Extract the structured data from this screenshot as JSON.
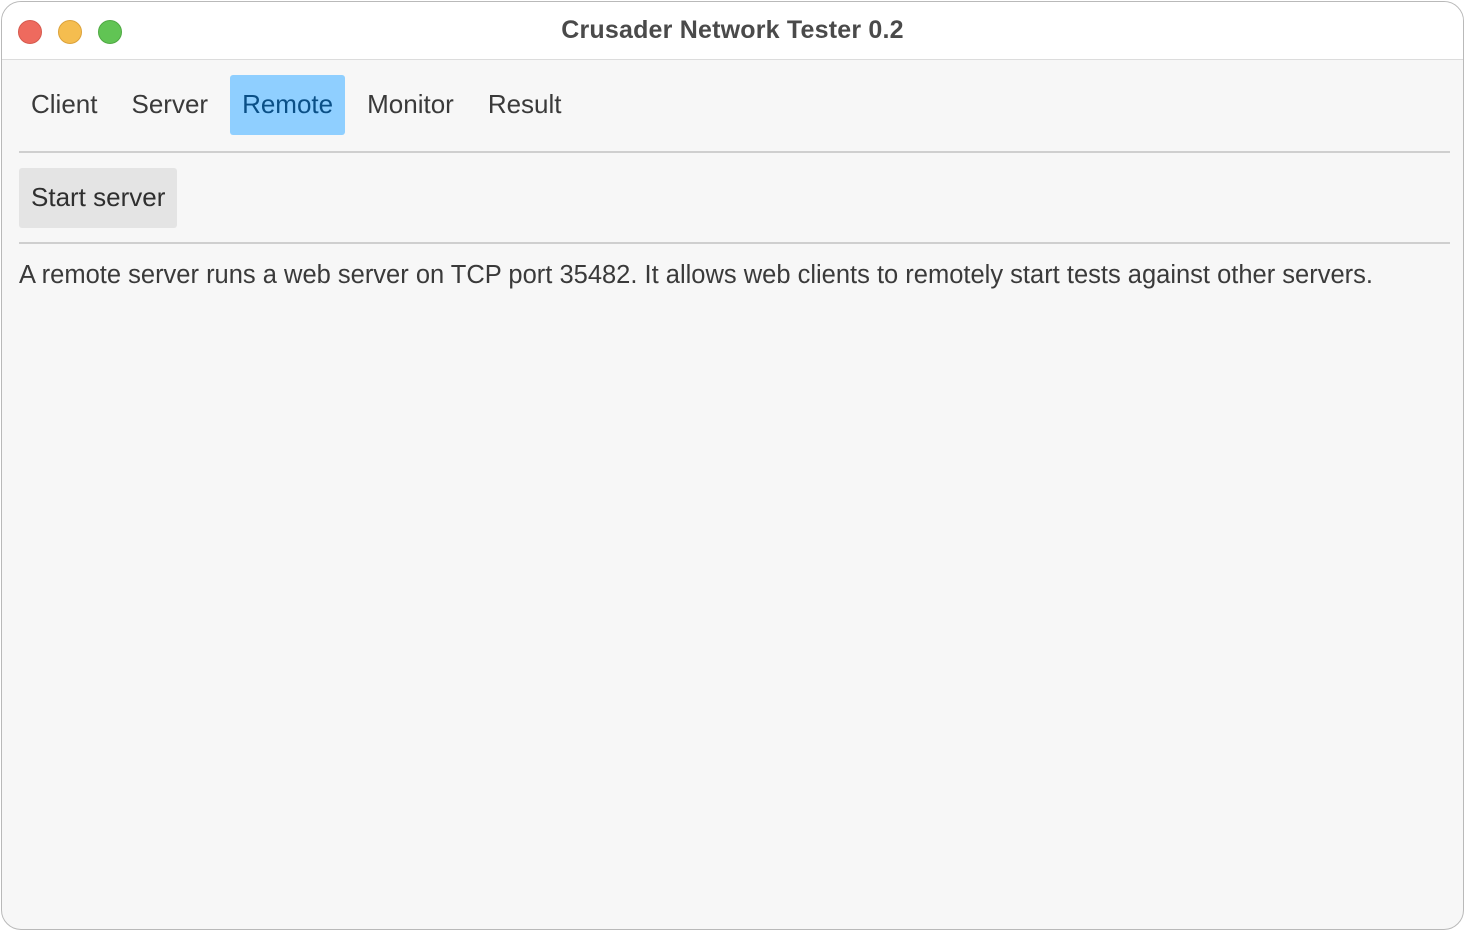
{
  "window": {
    "title": "Crusader Network Tester 0.2",
    "controls": [
      {
        "name": "close",
        "color": "#ee6a5e",
        "border": "#d65a4e"
      },
      {
        "name": "minimize",
        "color": "#f5bd4f",
        "border": "#dca23a"
      },
      {
        "name": "zoom",
        "color": "#61c454",
        "border": "#4fa943"
      }
    ]
  },
  "tabs": [
    {
      "label": "Client",
      "active": false
    },
    {
      "label": "Server",
      "active": false
    },
    {
      "label": "Remote",
      "active": true
    },
    {
      "label": "Monitor",
      "active": false
    },
    {
      "label": "Result",
      "active": false
    }
  ],
  "remote": {
    "start_button_label": "Start server",
    "description": "A remote server runs a web server on TCP port 35482. It allows web clients to remotely start tests against other servers."
  }
}
